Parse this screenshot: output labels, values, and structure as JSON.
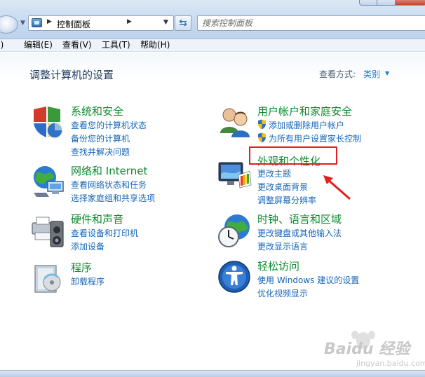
{
  "address": {
    "path": "控制面板",
    "search_placeholder": "搜索控制面板"
  },
  "menu": {
    "file": "(F)",
    "edit": "编辑(E)",
    "view": "查看(V)",
    "tools": "工具(T)",
    "help": "帮助(H)"
  },
  "page": {
    "title": "调整计算机的设置",
    "view_by_label": "查看方式:",
    "view_by_value": "类别"
  },
  "categories": {
    "system": {
      "title": "系统和安全",
      "icon": "shield-security-icon",
      "links": [
        "查看您的计算机状态",
        "备份您的计算机",
        "查找并解决问题"
      ]
    },
    "network": {
      "title": "网络和 Internet",
      "icon": "network-globe-icon",
      "links": [
        "查看网络状态和任务",
        "选择家庭组和共享选项"
      ]
    },
    "hardware": {
      "title": "硬件和声音",
      "icon": "printer-speaker-icon",
      "links": [
        "查看设备和打印机",
        "添加设备"
      ]
    },
    "programs": {
      "title": "程序",
      "icon": "programs-box-icon",
      "links": [
        "卸载程序"
      ]
    },
    "users": {
      "title": "用户帐户和家庭安全",
      "icon": "users-icon",
      "links": [
        "添加或删除用户帐户",
        "为所有用户设置家长控制"
      ]
    },
    "appearance": {
      "title": "外观和个性化",
      "icon": "monitor-palette-icon",
      "links": [
        "更改主题",
        "更改桌面背景",
        "调整屏幕分辨率"
      ]
    },
    "clock": {
      "title": "时钟、语言和区域",
      "icon": "clock-globe-icon",
      "links": [
        "更改键盘或其他输入法",
        "更改显示语言"
      ]
    },
    "access": {
      "title": "轻松访问",
      "icon": "ease-of-access-icon",
      "links": [
        "使用 Windows 建议的设置",
        "优化视频显示"
      ]
    }
  },
  "watermark": {
    "brand": "Baidu 经验",
    "url": "jingyan.baidu.com"
  },
  "colors": {
    "category_title": "#0a8a2f",
    "link": "#1466b8",
    "highlight": "#e02020"
  }
}
